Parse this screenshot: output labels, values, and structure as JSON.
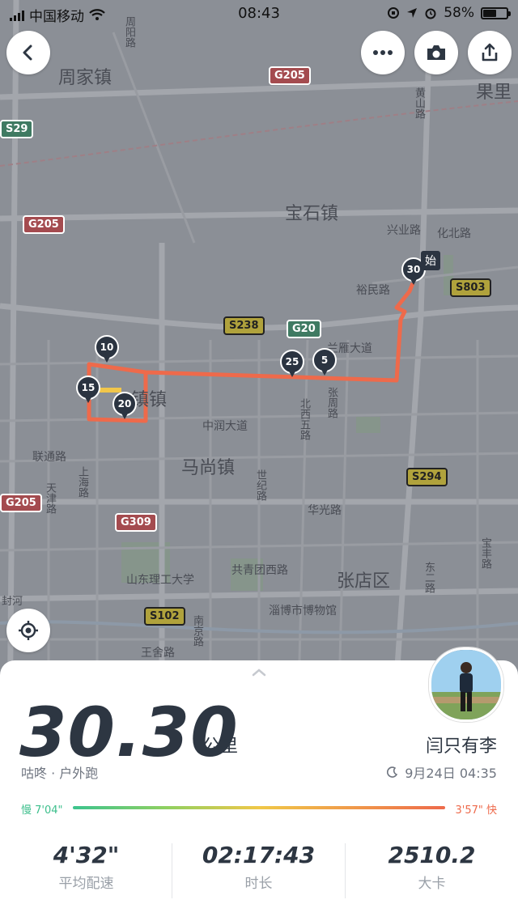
{
  "status_bar": {
    "carrier": "中国移动",
    "time": "08:43",
    "battery": "58%",
    "battery_level": 0.58
  },
  "toolbar": {
    "back_icon": "chevron-left-icon",
    "more_icon": "more-dots-icon",
    "camera_icon": "camera-icon",
    "share_icon": "share-icon"
  },
  "map": {
    "places": {
      "zhoujia": "周家镇",
      "guoli": "果里",
      "baoshi": "宝石镇",
      "town": "镇镇",
      "mashang": "马尚镇",
      "zhangdian": "张店区",
      "university": "山东理工大学",
      "museum": "淄博市博物馆"
    },
    "roads": {
      "zhouyang": "周阳路",
      "huangshan": "黄山路",
      "xingye": "兴业路",
      "huabei": "化北路",
      "yumin": "裕民路",
      "lanyan": "兰雁大道",
      "zhongrun": "中润大道",
      "beixi5": "北西五路",
      "zhangzhou": "张周路",
      "liantong": "联通路",
      "tianjin": "天津路",
      "shanghai": "上海路",
      "shiji": "世纪路",
      "huaguang": "华光路",
      "gongqingtuan": "共青团西路",
      "nanjing": "南京路",
      "wangshe": "王舍路",
      "dong2": "东二路",
      "baofeng": "宝丰路",
      "fenghe": "封河"
    },
    "highway_signs": [
      "G205",
      "S29",
      "G205",
      "S238",
      "G20",
      "S803",
      "S294",
      "G205",
      "G309",
      "S102"
    ],
    "km_markers": [
      "30",
      "25",
      "5",
      "10",
      "15",
      "20"
    ],
    "start_label": "始",
    "locate_icon": "locate-icon"
  },
  "run": {
    "distance": "30.30",
    "unit": "公里",
    "user_name": "闫只有李",
    "source": "咕咚 · 户外跑",
    "datetime": "9月24日 04:35",
    "moon_icon": "moon-icon",
    "pace_slow": "慢 7'04\"",
    "pace_fast": "3'57\" 快"
  },
  "stats": [
    {
      "value": "4'32\"",
      "label": "平均配速"
    },
    {
      "value": "02:17:43",
      "label": "时长"
    },
    {
      "value": "2510.2",
      "label": "大卡"
    }
  ],
  "colors": {
    "route": "#ee6a4b",
    "accent_dark": "#2d3642",
    "pace_slow": "#3cbf8c",
    "pace_fast": "#ee6a4b"
  }
}
